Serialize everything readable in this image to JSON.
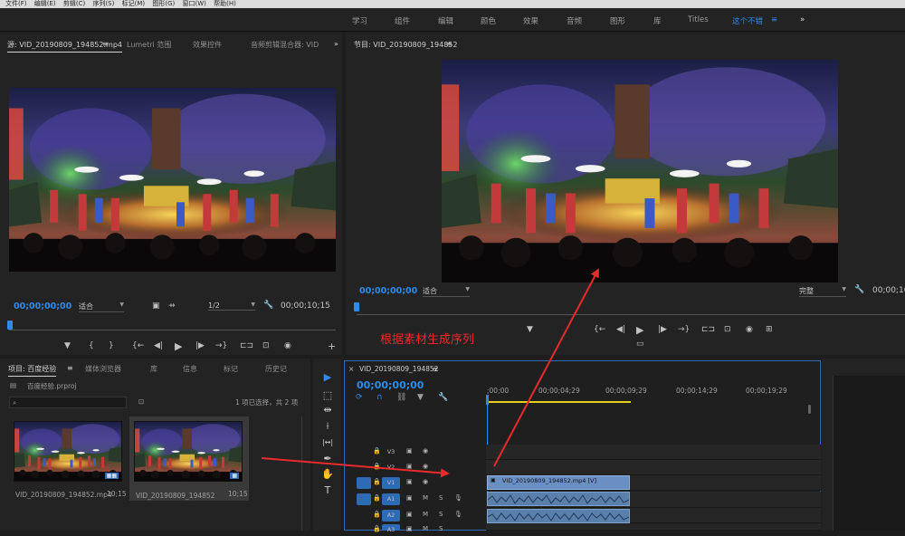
{
  "menubar": {
    "items": [
      "文件(F)",
      "编辑(E)",
      "剪辑(C)",
      "序列(S)",
      "标记(M)",
      "图形(G)",
      "窗口(W)",
      "帮助(H)"
    ]
  },
  "workspaces": {
    "items": [
      "学习",
      "组件",
      "编辑",
      "颜色",
      "效果",
      "音频",
      "图形",
      "库",
      "Titles",
      "这个不错"
    ],
    "more": "»",
    "menu_icon": "≡"
  },
  "source_panel": {
    "tabs": [
      "源: VID_20190809_194852.mp4",
      "Lumetri 范围",
      "效果控件",
      "音频剪辑混合器: VID"
    ],
    "menu_icon": "≡",
    "more": "»",
    "timecode_in": "00;00;00;00",
    "fit": "适合",
    "resolution": "1/2",
    "timecode_dur": "00;00;10;15",
    "controls": [
      "▼",
      "{",
      "}",
      "{←",
      "◀|",
      "▶",
      "|▶",
      "→}",
      "⊏⊐",
      "⊡",
      "◉"
    ],
    "add": "+"
  },
  "program_panel": {
    "tab": "节目: VID_20190809_194852",
    "menu_icon": "≡",
    "timecode_in": "00;00;00;00",
    "fit": "适合",
    "quality": "完整",
    "timecode_dur": "00;00;10",
    "controls": [
      "▼",
      "{←",
      "◀|",
      "▶",
      "|▶",
      "→}",
      "⊏⊐",
      "⊡",
      "◉",
      "⊞"
    ],
    "extra": "▭"
  },
  "annotation": "根据素材生成序列",
  "project_panel": {
    "tabs": [
      "项目: 百度经验",
      "媒体浏览器",
      "库",
      "信息",
      "标记",
      "历史记"
    ],
    "menu_icon": "≡",
    "project_file": "百度经验.prproj",
    "search_placeholder": "",
    "selection_info": "1 项已选择，共 2 项",
    "items": [
      {
        "name": "VID_20190809_194852.mp4",
        "duration": "10;15"
      },
      {
        "name": "VID_20190809_194852",
        "duration": "10;15"
      }
    ]
  },
  "tools": [
    "▶",
    "⬚",
    "⇹",
    "⟊",
    "|↔|",
    "✒",
    "✋",
    "T"
  ],
  "timeline": {
    "close": "×",
    "tab": "VID_20190809_194852",
    "menu_icon": "≡",
    "timecode": "00;00;00;00",
    "ruler": [
      ";00;00",
      "00;00;04;29",
      "00;00;09;29",
      "00;00;14;29",
      "00;00;19;29"
    ],
    "tracks": [
      {
        "id": "V3",
        "type": "video"
      },
      {
        "id": "V2",
        "type": "video"
      },
      {
        "id": "V1",
        "type": "video",
        "active": true
      },
      {
        "id": "A1",
        "type": "audio",
        "active": true
      },
      {
        "id": "A2",
        "type": "audio"
      },
      {
        "id": "A3",
        "type": "audio"
      }
    ],
    "video_clip": "VID_20190809_194852.mp4 [V]",
    "audio_m": "M",
    "audio_s": "S"
  },
  "colors": {
    "accent": "#2d8ceb",
    "annotation": "#e82b2b",
    "clip_video": "#6a8fc2",
    "clip_audio": "#5a7faa",
    "playhead": "#e8d21f"
  }
}
